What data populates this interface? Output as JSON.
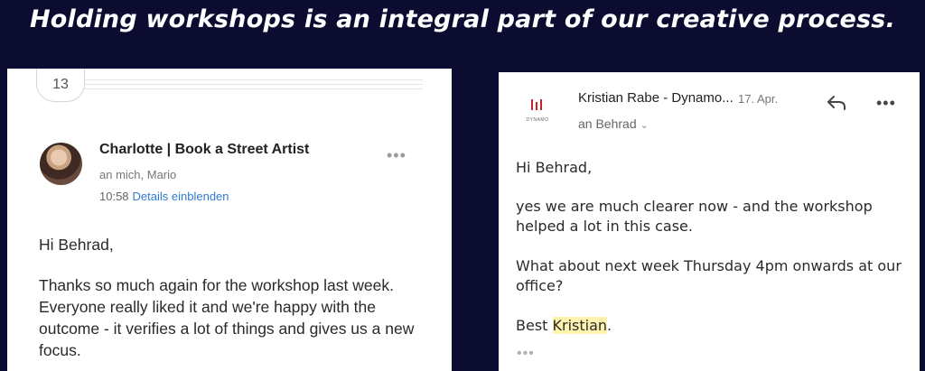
{
  "headline": "Holding workshops is an integral part of our creative process.",
  "left_email": {
    "thread_count": "13",
    "sender": "Charlotte | Book a Street Artist",
    "recipients": "an mich, Mario",
    "time": "10:58",
    "details_link": "Details einblenden",
    "more": "•••",
    "greeting": "Hi Behrad,",
    "body": "Thanks so much again for the workshop last week. Everyone really liked it and we're happy with the outcome - it verifies a lot of things and gives us a new focus."
  },
  "right_email": {
    "logo_text": "DYNAMO",
    "sender": "Kristian Rabe - Dynamo...",
    "date": "17. Apr.",
    "more": "•••",
    "recipient": "an Behrad",
    "greeting": "Hi Behrad,",
    "para1": "yes we are much clearer now - and the workshop helped a lot in this case.",
    "para2": "What about next week Thursday 4pm onwards at our office?",
    "sign_prefix": "Best ",
    "sign_name": "Kristian",
    "sign_suffix": ".",
    "trailing_more": "•••"
  },
  "colors": {
    "background": "#0b0c30",
    "link": "#2f7bd3",
    "highlight": "#fff3b0",
    "logo": "#c9242b"
  }
}
